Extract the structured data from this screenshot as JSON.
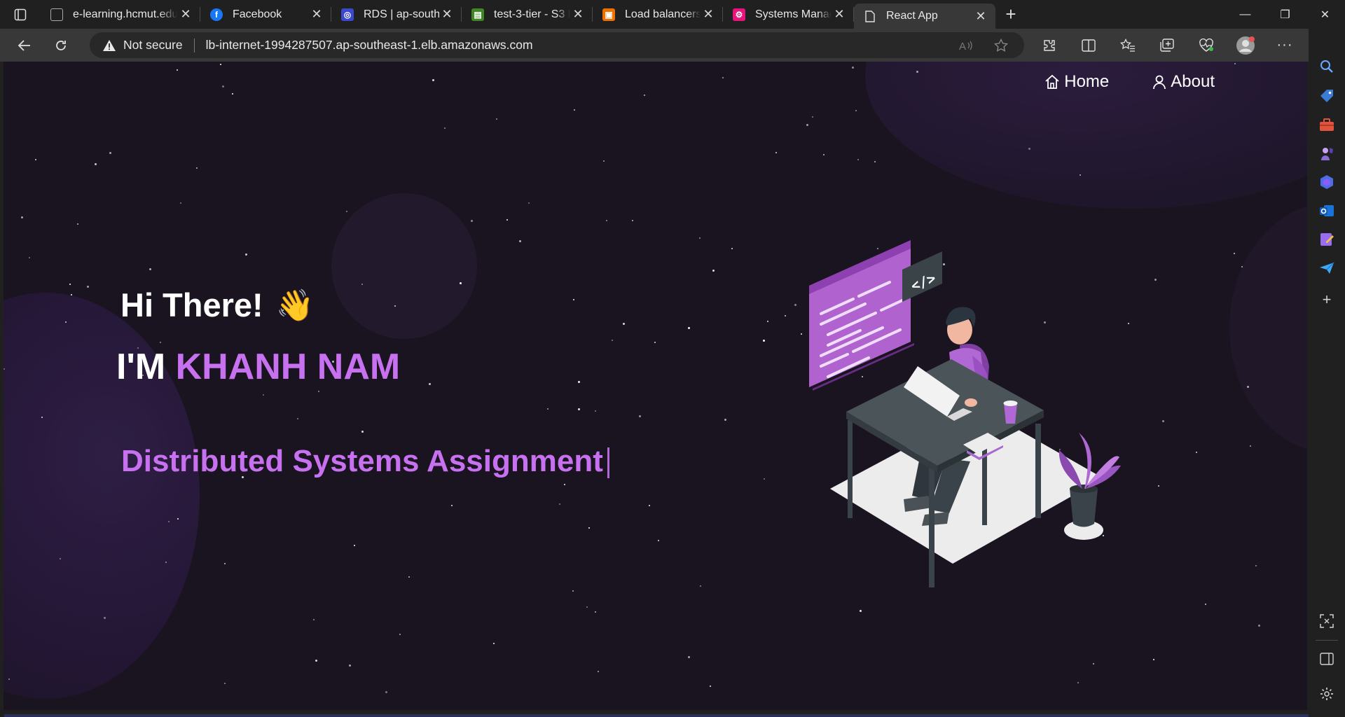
{
  "browser": {
    "tabs": [
      {
        "title": "e-learning.hcmut.edu.vn",
        "favicon": "elearning-page-icon",
        "color": "#444444"
      },
      {
        "title": "Facebook",
        "favicon": "facebook-icon",
        "color": "#1877f2"
      },
      {
        "title": "RDS | ap-southeast-1",
        "favicon": "aws-rds-icon",
        "color": "#3b48cc"
      },
      {
        "title": "test-3-tier - S3 bucket",
        "favicon": "aws-s3-icon",
        "color": "#3f8624"
      },
      {
        "title": "Load balancers | EC2 |",
        "favicon": "aws-ec2-icon",
        "color": "#ed7100"
      },
      {
        "title": "Systems Manager | ap-",
        "favicon": "aws-ssm-icon",
        "color": "#e7157b"
      },
      {
        "title": "React App",
        "favicon": "page-icon",
        "color": "#383838"
      }
    ],
    "address": {
      "security": "Not secure",
      "url": "lb-internet-1994287507.ap-southeast-1.elb.amazonaws.com"
    }
  },
  "nav": {
    "home": "Home",
    "about": "About"
  },
  "hero": {
    "greeting": "Hi There!",
    "wave": "👋",
    "prefix": "I'M",
    "name": "KHANH NAM",
    "typed": "Distributed Systems Assignment"
  },
  "colors": {
    "accent": "#c770f0",
    "background": "#1a1421"
  }
}
